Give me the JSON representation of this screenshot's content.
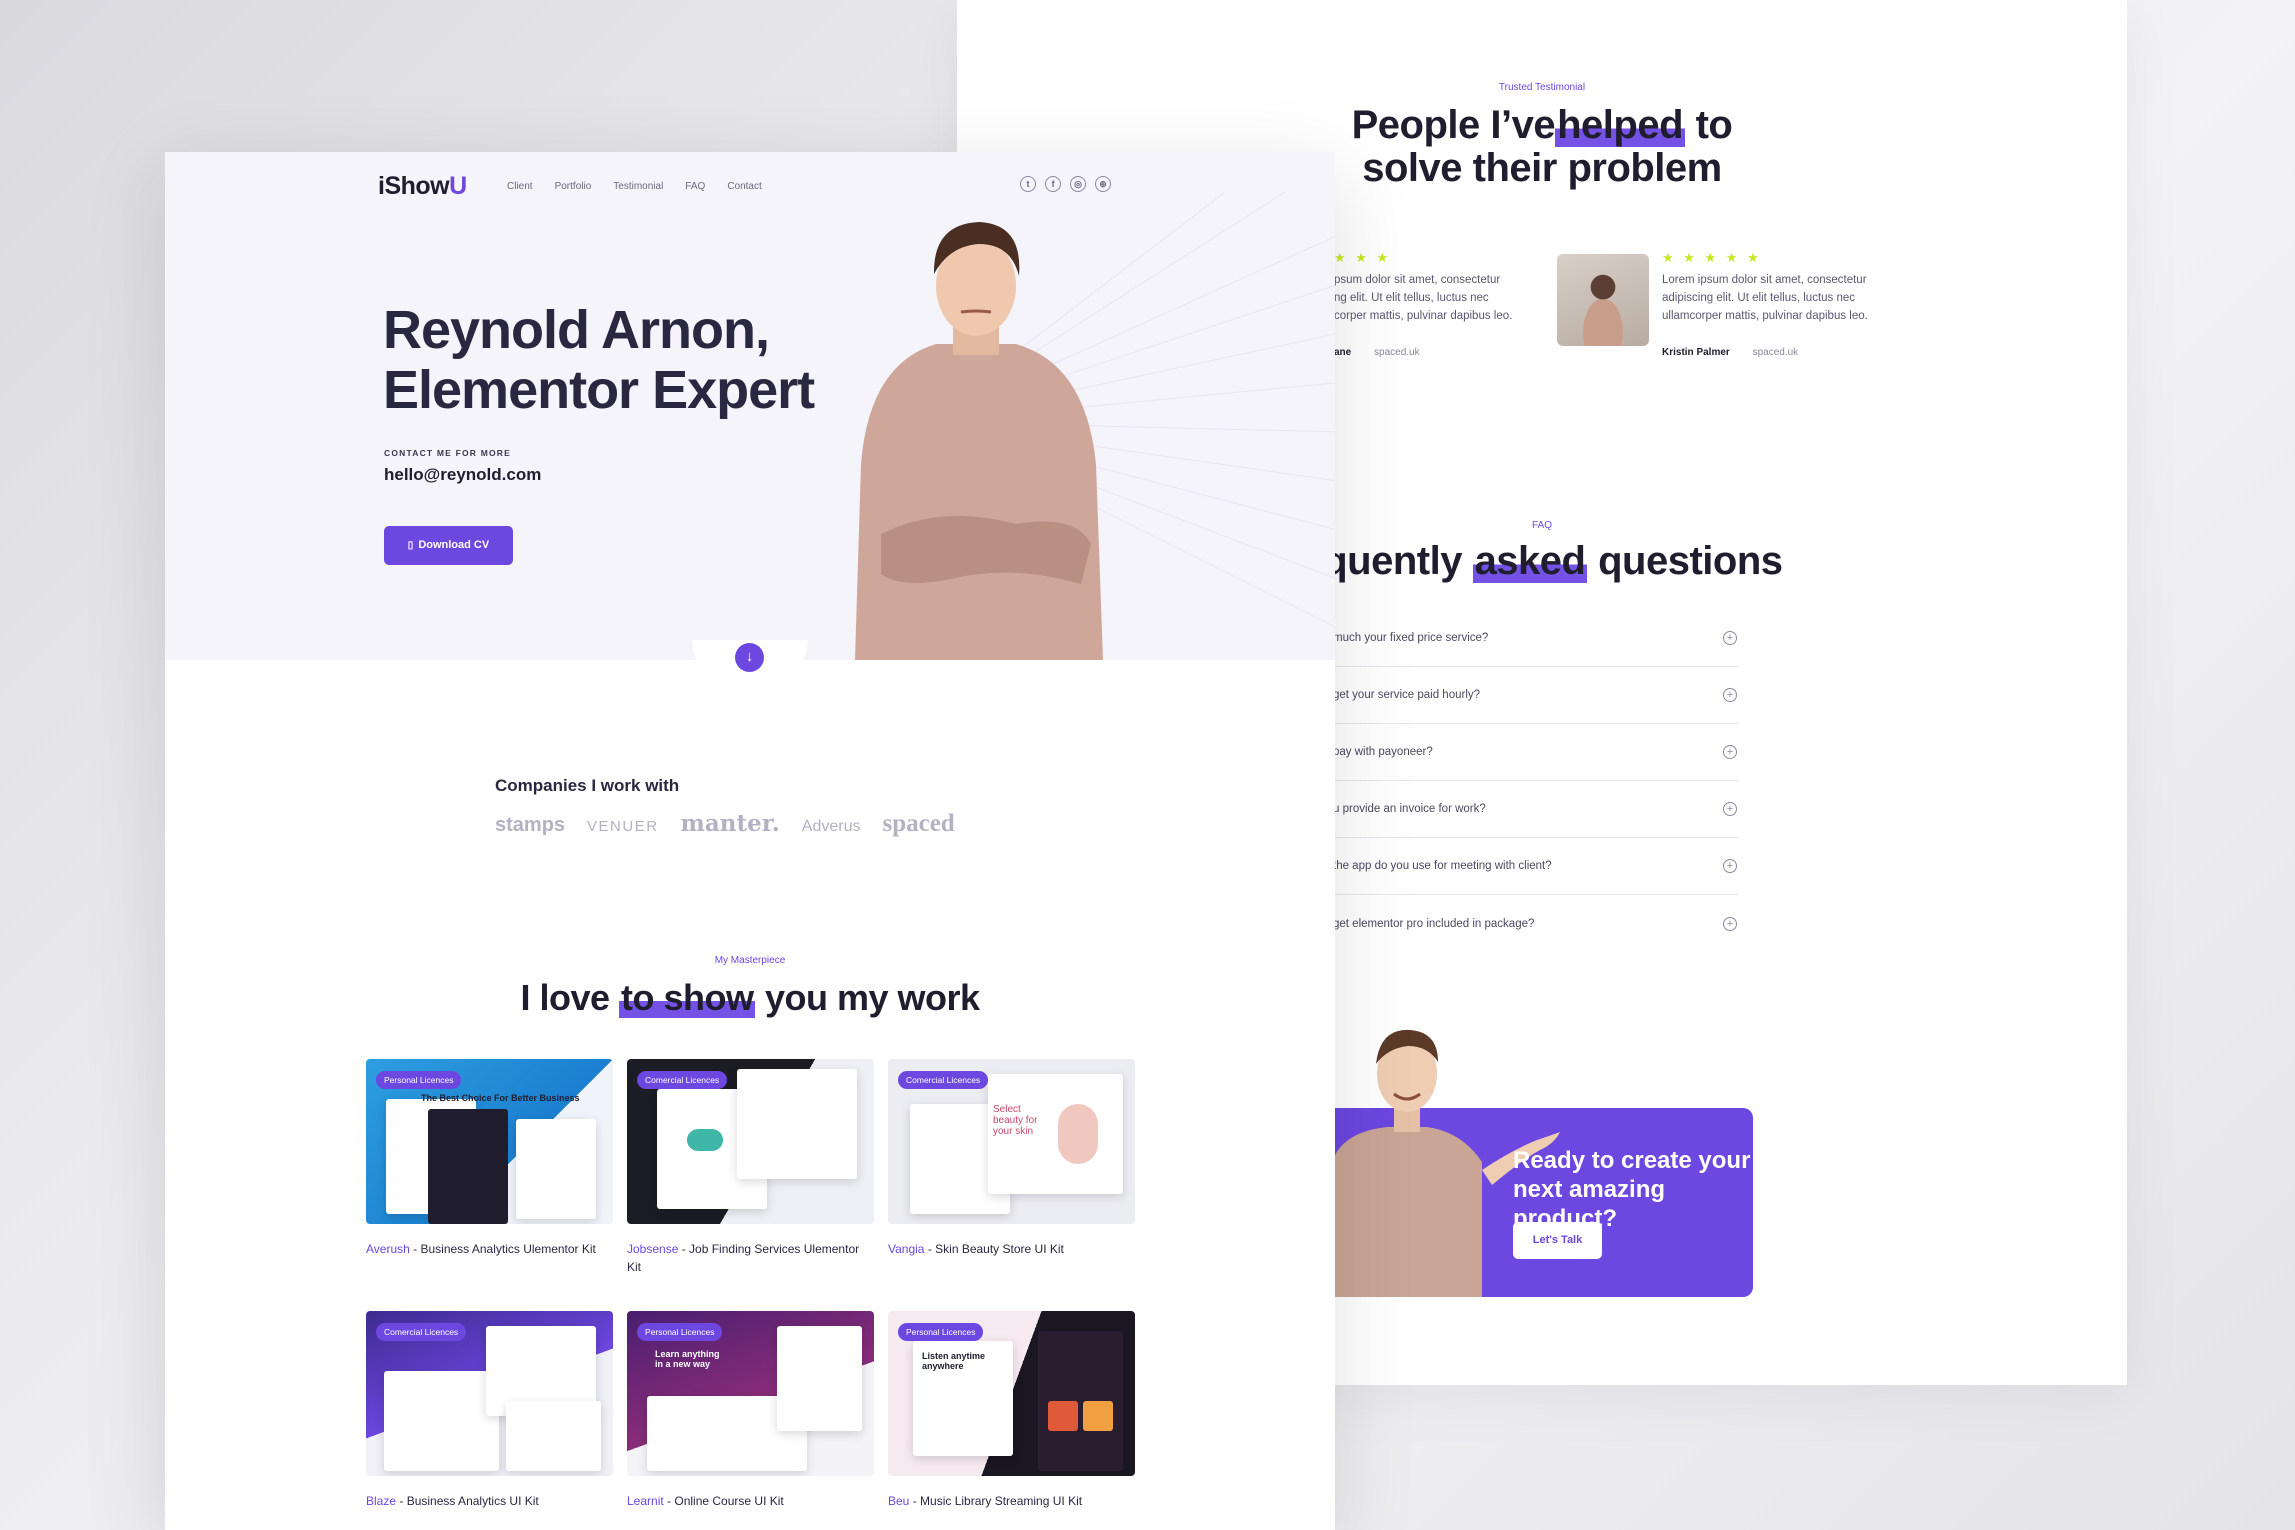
{
  "nav": {
    "logo": "iShow",
    "logo_accent": "U",
    "links": [
      "Client",
      "Portfolio",
      "Testimonial",
      "FAQ",
      "Contact"
    ],
    "social_icons": [
      "twitter-icon",
      "facebook-icon",
      "instagram-icon",
      "dribbble-icon"
    ]
  },
  "hero": {
    "title_line1": "Reynold Arnon,",
    "title_line2": "Elementor Expert",
    "contact_label": "CONTACT ME FOR MORE",
    "email": "hello@reynold.com",
    "cv_button": "Download CV",
    "scroll_icon": "arrow-down-icon"
  },
  "companies": {
    "label": "Companies I work with",
    "logos": [
      "stamps",
      "VENUER",
      "manter.",
      "Adverus",
      "spaced"
    ]
  },
  "work": {
    "eyebrow": "My Masterpiece",
    "title_before": "I love ",
    "title_highlight": "to show",
    "title_after": " you my work",
    "items": [
      {
        "badge": "Personal Licences",
        "name": "Averush",
        "desc": " - Business Analytics Ulementor Kit"
      },
      {
        "badge": "Comercial Licences",
        "name": "Jobsense",
        "desc": " - Job Finding Services Ulementor Kit"
      },
      {
        "badge": "Comercial Licences",
        "name": "Vangia",
        "desc": " - Skin Beauty Store UI Kit"
      },
      {
        "badge": "Comercial Licences",
        "name": "Blaze",
        "desc": " - Business Analytics UI Kit"
      },
      {
        "badge": "Personal Licences",
        "name": "Learnit",
        "desc": " - Online Course UI Kit"
      },
      {
        "badge": "Personal Licences",
        "name": "Beu",
        "desc": " - Music Library Streaming UI Kit"
      }
    ],
    "thumb_texts": {
      "averush": "The Best Choice For Better Business",
      "vangia": "Select beauty for your skin",
      "learnit": "Learn anything in a new way",
      "beu": "Listen anytime anywhere"
    }
  },
  "testimonial": {
    "eyebrow": "Trusted Testimonial",
    "title_line1_before": "People I’ve",
    "title_line1_highlight": "helped",
    "title_line1_after": " to",
    "title_line2": "solve their problem",
    "cards": [
      {
        "stars": "★ ★ ★",
        "text": "psum dolor sit amet, consectetur ng elit. Ut elit tellus, luctus nec corper mattis, pulvinar dapibus leo.",
        "name": "ane",
        "site": "spaced.uk"
      },
      {
        "stars": "★ ★ ★ ★ ★",
        "text": "Lorem ipsum dolor sit amet, consectetur adipiscing elit. Ut elit tellus, luctus nec ullamcorper mattis, pulvinar dapibus leo.",
        "name": "Kristin Palmer",
        "site": "spaced.uk"
      }
    ]
  },
  "faq": {
    "eyebrow": "FAQ",
    "title_before": "equently ",
    "title_highlight": "asked",
    "title_after": " questions",
    "items": [
      "much your fixed price service?",
      "get your service paid hourly?",
      "pay with payoneer?",
      "u provide an invoice for work?",
      "the app do you use for meeting with client?",
      "get elementor pro included in package?"
    ],
    "toggle_symbol": "+"
  },
  "cta": {
    "title": "Ready to create your next amazing product?",
    "button": "Let's Talk"
  },
  "colors": {
    "accent": "#6c47e0",
    "star": "#c7e820",
    "hero_bg": "#f5f4fb",
    "text_dark": "#1f1d2e"
  }
}
